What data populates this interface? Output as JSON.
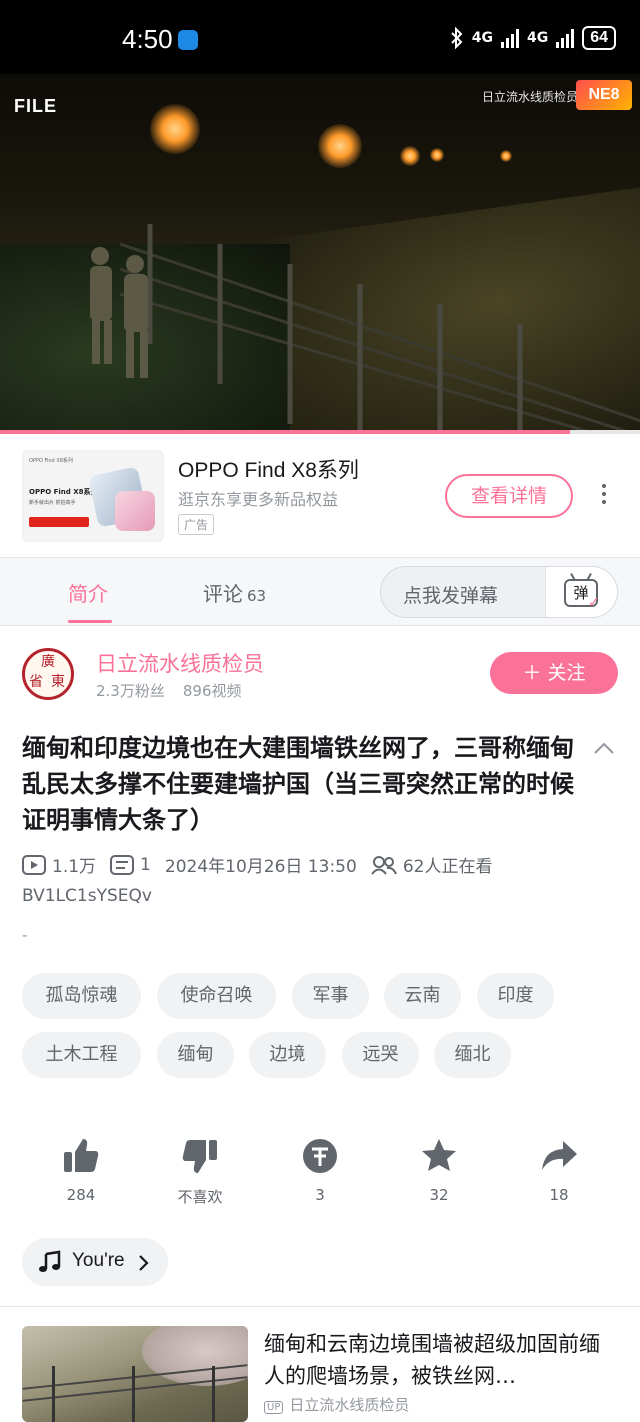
{
  "status_bar": {
    "time": "4:50",
    "network1": "4G",
    "network2": "4G",
    "battery": "64"
  },
  "video": {
    "file_label": "FILE",
    "watermark": "日立流水线质检员",
    "watermark_logo": "NE8",
    "progress_percent": 89
  },
  "ad": {
    "thumb_brand": "OPPO Find X8系列",
    "thumb_sub": "新手就出片 抓拍高手",
    "title": "OPPO Find X8系列",
    "subtitle": "逛京东享更多新品权益",
    "tag": "广告",
    "cta": "查看详情"
  },
  "tabs": {
    "intro": "简介",
    "comments": "评论",
    "comments_count": "63",
    "danmu_placeholder": "点我发弹幕",
    "danmu_button": "弹"
  },
  "author": {
    "avatar_chars": [
      "廣",
      "省",
      "東"
    ],
    "name": "日立流水线质检员",
    "fans": "2.3万粉丝",
    "videos": "896视频",
    "follow": "＋ 关注"
  },
  "video_info": {
    "title": "缅甸和印度边境也在大建围墙铁丝网了，三哥称缅甸乱民太多撑不住要建墙护国（当三哥突然正常的时候证明事情大条了）",
    "views": "1.1万",
    "danmaku_count": "1",
    "date": "2024年10月26日 13:50",
    "watching": "62人正在看",
    "bvid": "BV1LC1sYSEQv",
    "description": "-"
  },
  "tags": [
    "孤岛惊魂",
    "使命召唤",
    "军事",
    "云南",
    "印度",
    "土木工程",
    "缅甸",
    "边境",
    "远哭",
    "缅北"
  ],
  "actions": {
    "like": "284",
    "dislike": "不喜欢",
    "coin": "3",
    "favorite": "32",
    "share": "18"
  },
  "music": {
    "label": "You're"
  },
  "recommendation": {
    "title": "缅甸和云南边境围墙被超级加固前缅人的爬墙场景，被铁丝网…",
    "author": "日立流水线质检员",
    "up_badge": "UP"
  },
  "colors": {
    "accent": "#fb7299",
    "text": "#18191c",
    "secondary": "#61666d",
    "muted": "#9499a0",
    "pill_bg": "#f1f2f3"
  }
}
